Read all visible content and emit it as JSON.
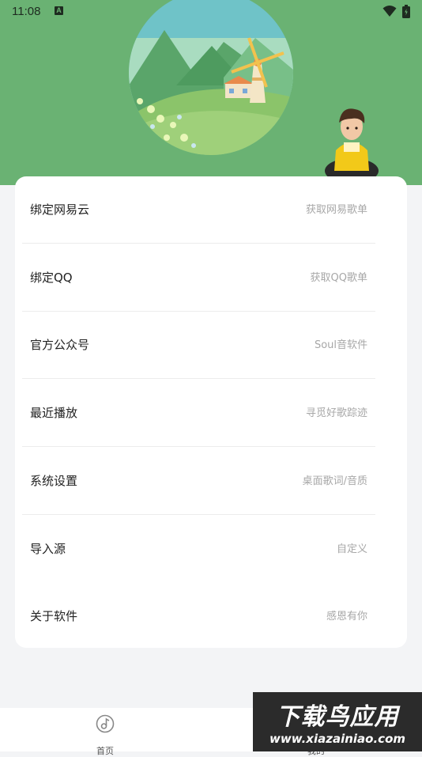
{
  "status_bar": {
    "time": "11:08",
    "notification_letter": "A"
  },
  "menu": [
    {
      "label": "绑定网易云",
      "desc": "获取网易歌单"
    },
    {
      "label": "绑定QQ",
      "desc": "获取QQ歌单"
    },
    {
      "label": "官方公众号",
      "desc": "Soul音软件"
    },
    {
      "label": "最近播放",
      "desc": "寻觅好歌踪迹"
    },
    {
      "label": "系统设置",
      "desc": "桌面歌词/音质"
    },
    {
      "label": "导入源",
      "desc": "自定义"
    },
    {
      "label": "关于软件",
      "desc": "感恩有你"
    }
  ],
  "bottom_nav": {
    "home_label": "首页",
    "second_label": "我的"
  },
  "watermark": {
    "title": "下载鸟应用",
    "url": "www.xiazainiao.com"
  },
  "colors": {
    "header_green": "#6ab273",
    "background": "#f3f4f6"
  },
  "icons": [
    "wifi-icon",
    "battery-icon",
    "notification-icon",
    "music-note-icon"
  ]
}
